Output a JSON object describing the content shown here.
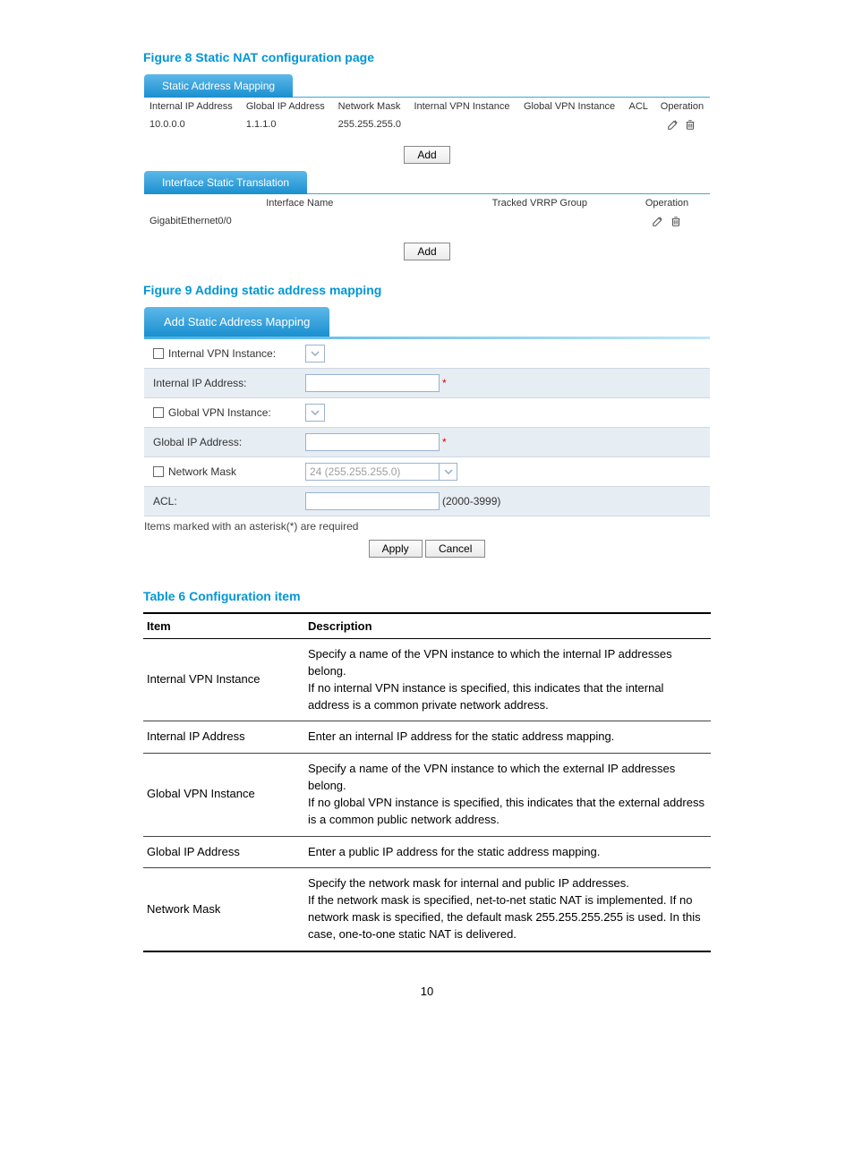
{
  "figure8": {
    "title": "Figure 8 Static NAT configuration page",
    "tab1": "Static Address Mapping",
    "headers": [
      "Internal IP Address",
      "Global IP Address",
      "Network Mask",
      "Internal VPN Instance",
      "Global VPN Instance",
      "ACL",
      "Operation"
    ],
    "row": {
      "internal_ip": "10.0.0.0",
      "global_ip": "1.1.1.0",
      "mask": "255.255.255.0",
      "int_vpn": "",
      "glob_vpn": "",
      "acl": ""
    },
    "add": "Add",
    "tab2": "Interface Static Translation",
    "headers2": [
      "Interface Name",
      "Tracked VRRP Group",
      "Operation"
    ],
    "row2": {
      "ifname": "GigabitEthernet0/0",
      "vrrp": ""
    },
    "add2": "Add"
  },
  "figure9": {
    "title": "Figure 9 Adding static address mapping",
    "tab": "Add Static Address Mapping",
    "fields": {
      "int_vpn_label": "Internal VPN Instance:",
      "int_ip_label": "Internal IP Address:",
      "glob_vpn_label": "Global VPN Instance:",
      "glob_ip_label": "Global IP Address:",
      "mask_label": "Network Mask",
      "mask_placeholder": "24 (255.255.255.0)",
      "acl_label": "ACL:",
      "acl_hint": "(2000-3999)"
    },
    "note": "Items marked with an asterisk(*) are required",
    "apply": "Apply",
    "cancel": "Cancel"
  },
  "table6": {
    "title": "Table 6 Configuration item",
    "headers": [
      "Item",
      "Description"
    ],
    "rows": [
      {
        "item": "Internal VPN Instance",
        "desc": "Specify a name of the VPN instance to which the internal IP addresses belong.\nIf no internal VPN instance is specified, this indicates that the internal address is a common private network address."
      },
      {
        "item": "Internal IP Address",
        "desc": "Enter an internal IP address for the static address mapping."
      },
      {
        "item": "Global VPN Instance",
        "desc": "Specify a name of the VPN instance to which the external IP addresses belong.\nIf no global VPN instance is specified, this indicates that the external address is a common public network address."
      },
      {
        "item": "Global IP Address",
        "desc": "Enter a public IP address for the static address mapping."
      },
      {
        "item": "Network Mask",
        "desc": "Specify the network mask for internal and public IP addresses.\nIf the network mask is specified, net-to-net static NAT is implemented. If no network mask is specified, the default mask 255.255.255.255 is used. In this case, one-to-one static NAT is delivered."
      }
    ]
  },
  "page_number": "10"
}
